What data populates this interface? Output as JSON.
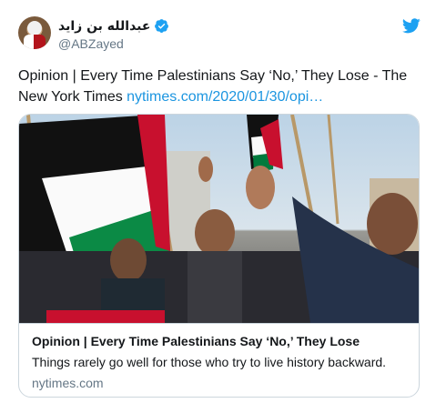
{
  "tweet": {
    "display_name": "عبدالله بن زايد",
    "handle": "@ABZayed",
    "text_prefix": "Opinion | Every Time Palestinians Say ‘No,’ They Lose - The New York Times ",
    "link_text": "nytimes.com/2020/01/30/opi…"
  },
  "card": {
    "title": "Opinion | Every Time Palestinians Say ‘No,’ They Lose",
    "description": "Things rarely go well for those who try to live history backward.",
    "domain": "nytimes.com"
  },
  "icons": {
    "verified": "verified-badge-icon",
    "logo": "twitter-bird-icon"
  },
  "colors": {
    "link": "#1b95e0",
    "secondary_text": "#657786",
    "border": "#ccd6dd",
    "flag_red": "#c8102e",
    "flag_green": "#007a3d"
  }
}
